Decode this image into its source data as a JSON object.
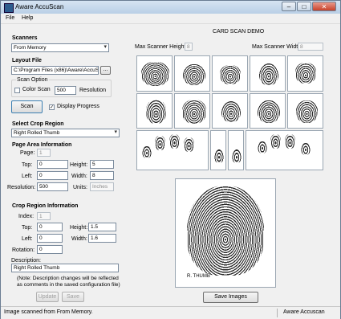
{
  "window": {
    "title": "Aware AccuScan"
  },
  "menu": {
    "file": "File",
    "help": "Help"
  },
  "scanners": {
    "heading": "Scanners",
    "selected": "From Memory"
  },
  "layout_file": {
    "heading": "Layout File",
    "value": "C:\\Program Files (x86)\\Aware\\AccuSca",
    "browse": "..."
  },
  "scan_option": {
    "title": "Scan Option",
    "color_scan": "Color Scan",
    "resolution_value": "500",
    "resolution_label": "Resolution"
  },
  "scan": {
    "button": "Scan",
    "display_progress": "Display Progress"
  },
  "crop_region": {
    "heading": "Select Crop Region",
    "selected": "Right Rolled Thumb"
  },
  "page_area": {
    "heading": "Page Area Information",
    "page_label": "Page:",
    "page": "1",
    "top_label": "Top:",
    "top": "0",
    "left_label": "Left:",
    "left": "0",
    "height_label": "Height:",
    "height": "5",
    "width_label": "Width:",
    "width": "8",
    "resolution_label": "Resolution:",
    "resolution": "500",
    "units_label": "Units:",
    "units": "Inches"
  },
  "crop_info": {
    "heading": "Crop Region Information",
    "index_label": "Index:",
    "index": "1",
    "top_label": "Top:",
    "top": "0",
    "left_label": "Left:",
    "left": "0",
    "height_label": "Height:",
    "height": "1.5",
    "width_label": "Width:",
    "width": "1.6",
    "rotation_label": "Rotation:",
    "rotation": "0"
  },
  "description": {
    "label": "Description:",
    "value": "Right Rolled Thumb",
    "note_line1": "(Note: Description changes will be reflected",
    "note_line2": "as comments in the saved configuration file)"
  },
  "actions": {
    "update": "Update",
    "save": "Save",
    "save_images": "Save Images"
  },
  "card": {
    "title": "CARD SCAN DEMO",
    "max_height_label": "Max Scanner Height:",
    "max_height": "8",
    "max_width_label": "Max Scanner Width:",
    "max_width": "8",
    "thumb_caption": "R. THUMB"
  },
  "status": {
    "message": "Image scanned from From Memory.",
    "app": "Aware Accuscan"
  },
  "icons": {
    "minimize": "minimize-icon",
    "maximize": "maximize-icon",
    "close": "close-icon",
    "app": "app-icon",
    "dropdown": "chevron-down-icon",
    "check": "check-icon"
  }
}
